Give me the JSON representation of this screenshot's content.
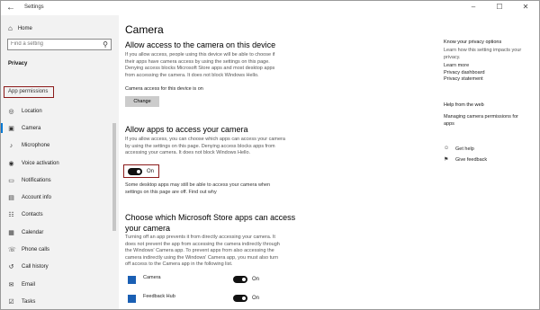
{
  "window": {
    "title": "Settings",
    "back_glyph": "←",
    "minimize_glyph": "–",
    "maximize_glyph": "☐",
    "close_glyph": "✕"
  },
  "sidebar": {
    "home_label": "Home",
    "search_placeholder": "Find a setting",
    "section_title": "Privacy",
    "app_permissions_header": "App permissions",
    "items": [
      {
        "label": "Location",
        "icon": "location-icon",
        "glyph": "◎"
      },
      {
        "label": "Camera",
        "icon": "camera-icon",
        "glyph": "▣",
        "selected": true
      },
      {
        "label": "Microphone",
        "icon": "microphone-icon",
        "glyph": "♪"
      },
      {
        "label": "Voice activation",
        "icon": "voice-activation-icon",
        "glyph": "◉"
      },
      {
        "label": "Notifications",
        "icon": "notifications-icon",
        "glyph": "▭"
      },
      {
        "label": "Account info",
        "icon": "account-info-icon",
        "glyph": "▤"
      },
      {
        "label": "Contacts",
        "icon": "contacts-icon",
        "glyph": "☷"
      },
      {
        "label": "Calendar",
        "icon": "calendar-icon",
        "glyph": "▦"
      },
      {
        "label": "Phone calls",
        "icon": "phone-calls-icon",
        "glyph": "☏"
      },
      {
        "label": "Call history",
        "icon": "call-history-icon",
        "glyph": "↺"
      },
      {
        "label": "Email",
        "icon": "email-icon",
        "glyph": "✉"
      },
      {
        "label": "Tasks",
        "icon": "tasks-icon",
        "glyph": "☑"
      }
    ]
  },
  "main": {
    "title": "Camera",
    "device_section": {
      "heading": "Allow access to the camera on this device",
      "lines": [
        "If you allow access, people using this device will be able to choose if",
        "their apps have camera access by using the settings on this page.",
        "Denying access blocks Microsoft Store apps and most desktop apps",
        "from accessing the camera. It does not block Windows Hello."
      ],
      "status": "Camera access for this device is on",
      "button_label": "Change"
    },
    "apps_section": {
      "heading": "Allow apps to access your camera",
      "lines": [
        "If you allow access, you can choose which apps can access your camera",
        "by using the settings on this page. Denying access blocks apps from",
        "accessing your camera. It does not block Windows Hello."
      ],
      "toggle_label": "On",
      "note_lines": [
        "Some desktop apps may still be able to access your camera when",
        "settings on this page are off. Find out why"
      ]
    },
    "store_section": {
      "heading_lines": [
        "Choose which Microsoft Store apps can access",
        "your camera"
      ],
      "lines": [
        "Turning off an app prevents it from directly accessing your camera. It",
        "does not prevent the app from accessing the camera indirectly through",
        "the Windows' Camera app. To prevent apps from also accessing the",
        "camera indirectly using the Windows' Camera app, you must also turn",
        "off access to the Camera app in the following list."
      ],
      "apps": [
        {
          "name": "Camera",
          "state": "On"
        },
        {
          "name": "Feedback Hub",
          "state": "On"
        }
      ]
    }
  },
  "right": {
    "privacy_heading": "Know your privacy options",
    "privacy_lines": [
      "Learn how this setting impacts your",
      "privacy."
    ],
    "links": [
      "Learn more",
      "Privacy dashboard",
      "Privacy statement"
    ],
    "web_heading": "Help from the web",
    "web_link_lines": [
      "Managing camera permissions for",
      "apps"
    ],
    "get_help": "Get help",
    "give_feedback": "Give feedback"
  },
  "colors": {
    "accent": "#0078d4",
    "highlight_box": "#8b1a1a",
    "sidebar_bg": "#f2f2f2",
    "toggle_on": "#111111"
  }
}
